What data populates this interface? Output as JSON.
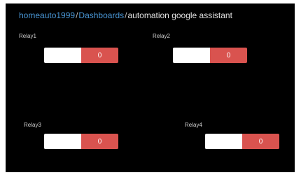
{
  "breadcrumb": {
    "user": "homeauto1999",
    "section": "Dashboards",
    "separator": "/",
    "current": "automation google assistant"
  },
  "widgets": [
    {
      "label": "Relay1",
      "value": "0"
    },
    {
      "label": "Relay2",
      "value": "0"
    },
    {
      "label": "Relay3",
      "value": "0"
    },
    {
      "label": "Relay4",
      "value": "0"
    }
  ],
  "colors": {
    "background": "#000000",
    "link": "#4a98d8",
    "relay_off": "#ffffff",
    "relay_value": "#d9534f"
  }
}
